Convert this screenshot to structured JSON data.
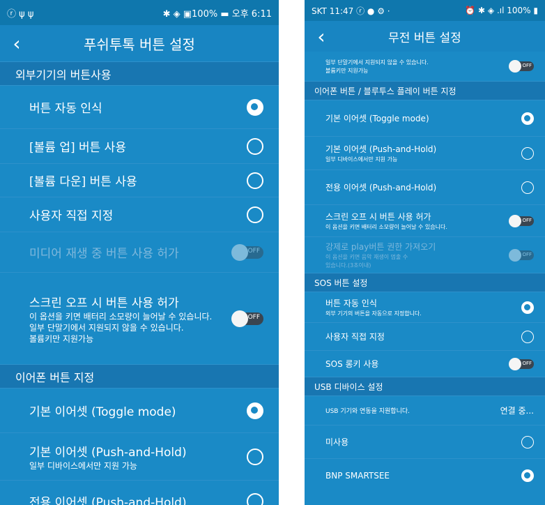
{
  "left": {
    "status": {
      "left": "ⓡ ψ ψ",
      "right": "✱ ◈ ▣100% ▬ 오후 6:11"
    },
    "title": "푸쉬투톡 버튼 설정",
    "sections": {
      "external": "외부기기의 버튼사용",
      "earphone": "이어폰 버튼 지정"
    },
    "rows": {
      "auto": "버튼 자동 인식",
      "vol_up": "[볼륨 업] 버튼 사용",
      "vol_down": "[볼륨 다운] 버튼 사용",
      "custom": "사용자 직접 지정",
      "media": "미디어 재생 중 버튼 사용 허가",
      "screen_off": "스크린 오프 시 버튼 사용 허가",
      "screen_off_sub": "이 옵션을 키면 배터리 소모량이 늘어날 수 있습니다.",
      "screen_off_sub2": "일부 단말기에서 지원되지 않을 수 있습니다.",
      "screen_off_sub3": "볼륨키만 지원가능",
      "toggle_basic": "기본 이어셋 (Toggle mode)",
      "push_basic": "기본 이어셋 (Push-and-Hold)",
      "push_basic_sub": "일부 디바이스에서만 지원 가능",
      "push_dedicated": "전용 이어셋 (Push-and-Hold)"
    },
    "toggle_off": "OFF"
  },
  "right": {
    "status": {
      "left": "SKT 11:47 ⓡ ● ⚙ ·",
      "right": "⏰ ✱ ◈ .ıl 100% ▮"
    },
    "title": "무전 버튼 설정",
    "top_sub": "일부 단말기에서 지원되지 않을 수 있습니다.",
    "top_sub2": "볼륨키만 지원가능",
    "sections": {
      "earphone_bt": "이어폰 버튼 / 블루투스 플레이 버튼 지정",
      "sos": "SOS 버튼 설정",
      "usb": "USB 디바이스 설정"
    },
    "rows": {
      "toggle_basic": "기본 이어셋 (Toggle mode)",
      "push_basic": "기본 이어셋 (Push-and-Hold)",
      "push_basic_sub": "일부 디바이스에서만 지원 가능",
      "push_dedicated": "전용 이어셋 (Push-and-Hold)",
      "screen_off": "스크린 오프 시 버튼 사용 허가",
      "screen_off_sub": "이 옵션을 키면 배터리 소모량이 늘어날 수 있습니다.",
      "force_play": "강제로 play버튼 권한 가져오기",
      "force_play_sub": "이 옵션을 키면 음악 재생이 멈출 수",
      "force_play_sub2": "있습니다.(3초이내)",
      "sos_auto": "버튼 자동 인식",
      "sos_auto_sub": "외부 기기의 버튼을 자동으로 지정합니다.",
      "sos_custom": "사용자 직접 지정",
      "sos_long": "SOS 롱키 사용",
      "usb_support": "USB 기기와 연동을 지원합니다.",
      "usb_status": "연결 중...",
      "unused": "미사용",
      "bnp": "BNP SMARTSEE"
    },
    "toggle_off": "OFF"
  }
}
